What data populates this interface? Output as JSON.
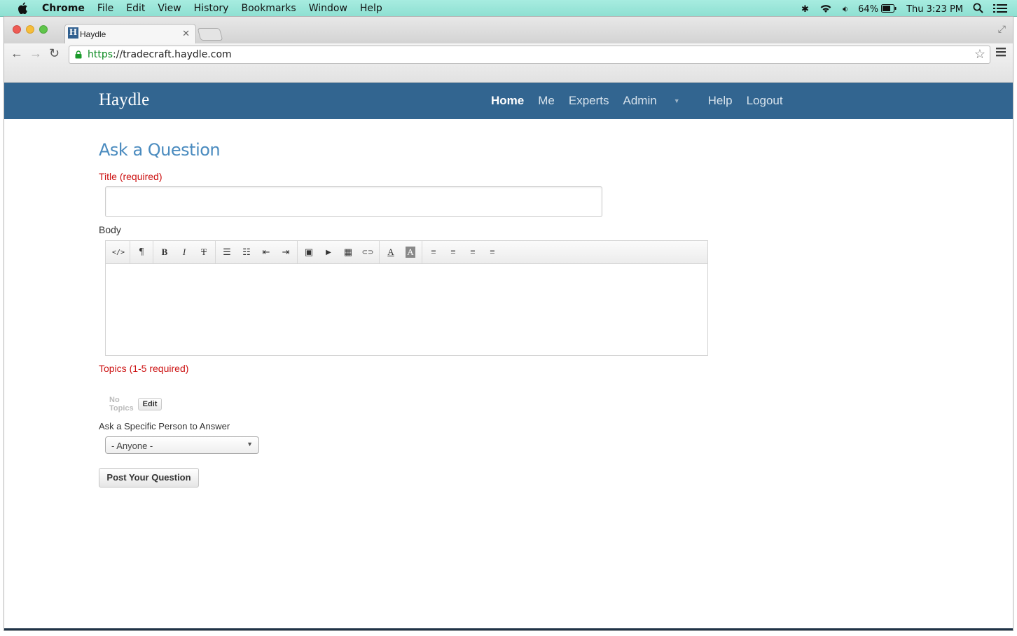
{
  "menubar": {
    "app": "Chrome",
    "items": [
      "File",
      "Edit",
      "View",
      "History",
      "Bookmarks",
      "Window",
      "Help"
    ],
    "battery": "64%",
    "clock": "Thu 3:23 PM"
  },
  "browser": {
    "tab_title": "Haydle",
    "url_scheme": "https",
    "url_rest": "://tradecraft.haydle.com"
  },
  "site": {
    "brand": "Haydle",
    "nav": [
      "Home",
      "Me",
      "Experts",
      "Admin",
      "Help",
      "Logout"
    ],
    "active_nav": "Home",
    "nav_color": "#326590"
  },
  "form": {
    "heading": "Ask a Question",
    "title_label": "Title (required)",
    "title_value": "",
    "body_label": "Body",
    "topics_label": "Topics (1-5 required)",
    "no_topics": "No Topics",
    "edit_label": "Edit",
    "person_label": "Ask a Specific Person to Answer",
    "person_selected": "- Anyone -",
    "submit_label": "Post Your Question",
    "required_color": "#cc1111"
  },
  "editor_toolbar": [
    [
      "html-source-icon",
      "</>"
    ],
    [
      "paragraph-format-icon",
      "¶"
    ],
    [
      "bold-icon",
      "B"
    ],
    [
      "italic-icon",
      "I"
    ],
    [
      "strikethrough-icon",
      "T"
    ],
    [
      "bullet-list-icon",
      "☰"
    ],
    [
      "numbered-list-icon",
      "☷"
    ],
    [
      "outdent-icon",
      "⇤"
    ],
    [
      "indent-icon",
      "⇥"
    ],
    [
      "image-icon",
      "▣"
    ],
    [
      "video-icon",
      "▶"
    ],
    [
      "table-icon",
      "▦"
    ],
    [
      "link-icon",
      "⊂⊃"
    ],
    [
      "font-color-icon",
      "A"
    ],
    [
      "background-color-icon",
      "A"
    ],
    [
      "align-left-icon",
      "≡"
    ],
    [
      "align-center-icon",
      "≡"
    ],
    [
      "align-right-icon",
      "≡"
    ],
    [
      "justify-icon",
      "≡"
    ]
  ]
}
